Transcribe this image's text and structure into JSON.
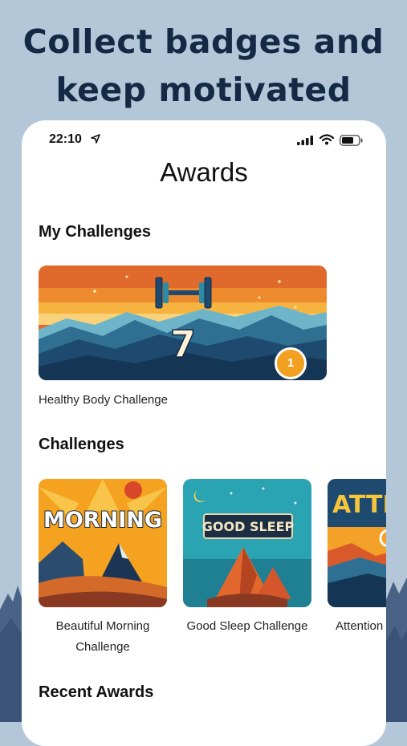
{
  "promo": {
    "line1": "Collect badges and",
    "line2": "keep motivated"
  },
  "status_bar": {
    "time": "22:10"
  },
  "page": {
    "title": "Awards"
  },
  "my_challenges": {
    "heading": "My Challenges",
    "items": [
      {
        "label": "Healthy Body Challenge",
        "badge_number": "7",
        "count": "1",
        "icon": "dumbbell-icon"
      }
    ]
  },
  "challenges": {
    "heading": "Challenges",
    "items": [
      {
        "label": "Beautiful Morning Challenge",
        "image_text": "MORNING"
      },
      {
        "label": "Good Sleep Challenge",
        "image_text": "GOOD SLEEP"
      },
      {
        "label": "Attention",
        "image_text": "ATTE"
      }
    ]
  },
  "recent_awards": {
    "heading": "Recent Awards"
  },
  "colors": {
    "background": "#b4c7d8",
    "title_text": "#142a44",
    "count_badge": "#f2a01f"
  }
}
